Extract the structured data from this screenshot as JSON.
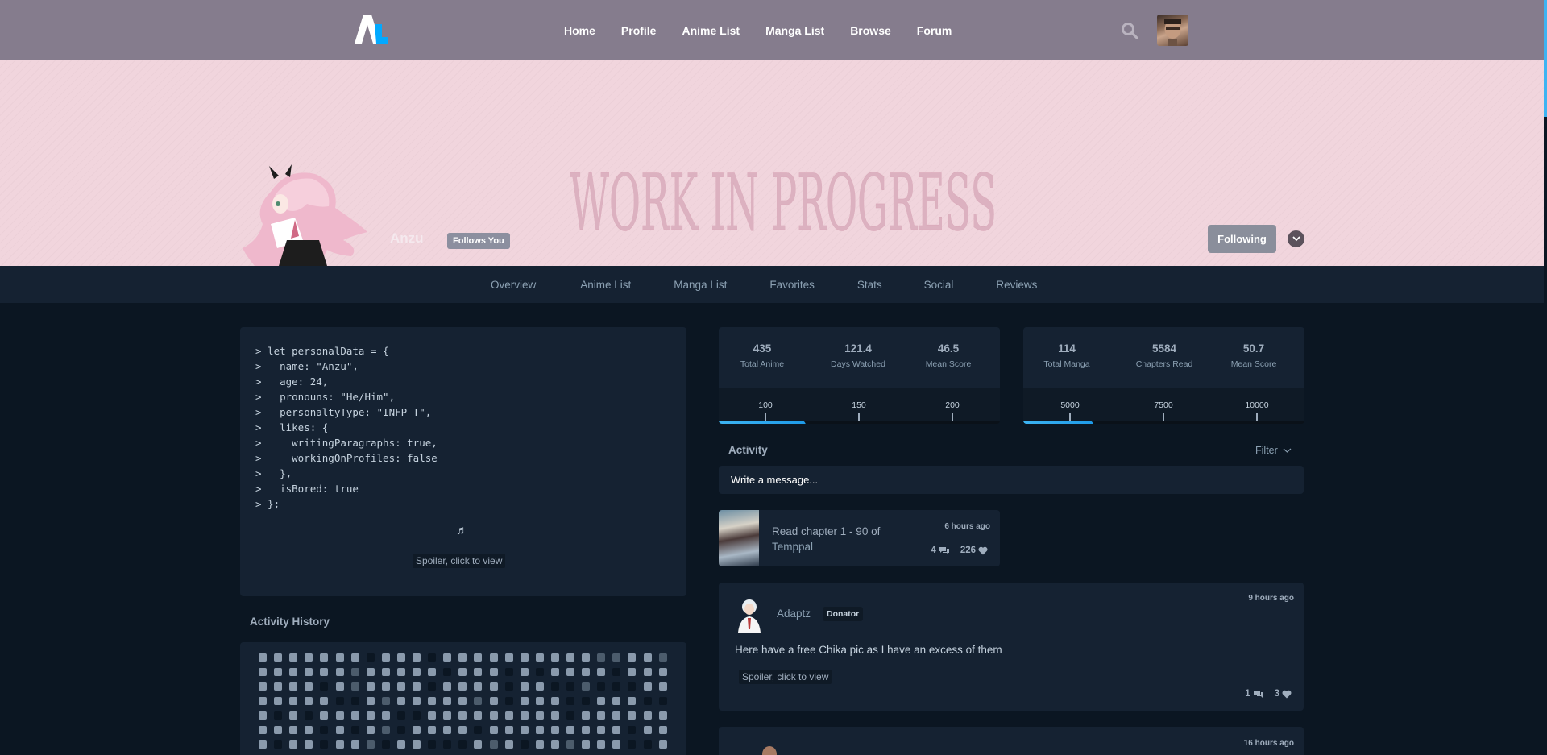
{
  "nav": {
    "links": [
      "Home",
      "Profile",
      "Anime List",
      "Manga List",
      "Browse",
      "Forum"
    ]
  },
  "banner": {
    "text": "WORK IN PROGRESS"
  },
  "profile": {
    "name": "Anzu",
    "follows_badge": "Follows You",
    "following_button": "Following"
  },
  "tabs": [
    "Overview",
    "Anime List",
    "Manga List",
    "Favorites",
    "Stats",
    "Social",
    "Reviews"
  ],
  "bio": {
    "code_lines": [
      "> let personalData = {",
      ">   name: \"Anzu\",",
      ">   age: 24,",
      ">   pronouns: \"He/Him\",",
      ">   personaltyType: \"INFP-T\",",
      ">   likes: {",
      ">     writingParagraphs: true,",
      ">     workingOnProfiles: false",
      ">   },",
      ">   isBored: true",
      "> };"
    ],
    "music_note": "♬",
    "spoiler": "Spoiler, click to view"
  },
  "activity_history": {
    "title": "Activity History"
  },
  "anime_stats": {
    "items": [
      {
        "value": "435",
        "label": "Total Anime"
      },
      {
        "value": "121.4",
        "label": "Days Watched"
      },
      {
        "value": "46.5",
        "label": "Mean Score"
      }
    ],
    "milestones": [
      "100",
      "150",
      "200"
    ],
    "progress": 0.31
  },
  "manga_stats": {
    "items": [
      {
        "value": "114",
        "label": "Total Manga"
      },
      {
        "value": "5584",
        "label": "Chapters Read"
      },
      {
        "value": "50.7",
        "label": "Mean Score"
      }
    ],
    "milestones": [
      "5000",
      "7500",
      "10000"
    ],
    "progress": 0.25
  },
  "activity": {
    "title": "Activity",
    "filter": "Filter",
    "message_placeholder": "Write a message...",
    "list_activity": {
      "text": "Read chapter 1 - 90 of",
      "title": "Temppal",
      "time": "6 hours ago",
      "replies": "4",
      "likes": "226"
    },
    "text_activity": {
      "user": "Adaptz",
      "badge": "Donator",
      "time": "9 hours ago",
      "text": "Here have a free Chika pic as I have an excess of them",
      "spoiler": "Spoiler, click to view",
      "replies": "1",
      "likes": "3"
    },
    "third_activity": {
      "time": "16 hours ago"
    }
  },
  "colors": {
    "nav_bg": "#857c8d",
    "banner_bg": "#f1d5dd",
    "page_bg": "#0b1622",
    "card_bg": "#152232",
    "accent": "#3db4f2"
  }
}
